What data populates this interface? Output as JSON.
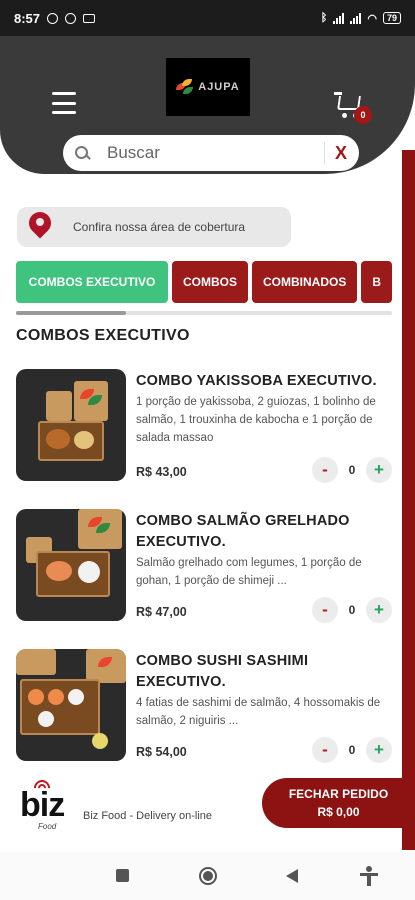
{
  "status_bar": {
    "time": "8:57",
    "battery": "79"
  },
  "header": {
    "logo_text": "AJUPA",
    "cart_count": "0",
    "search_placeholder": "Buscar",
    "search_clear": "X"
  },
  "coverage": {
    "label": "Confira nossa área de cobertura"
  },
  "tabs": [
    {
      "label": "COMBOS EXECUTIVO",
      "active": true
    },
    {
      "label": "COMBOS",
      "active": false
    },
    {
      "label": "COMBINADOS",
      "active": false
    },
    {
      "label": "B",
      "active": false
    }
  ],
  "section_title": "COMBOS EXECUTIVO",
  "products": [
    {
      "name": "COMBO YAKISSOBA EXECUTIVO.",
      "description": "1 porção de yakissoba, 2 guiozas, 1 bolinho de salmão, 1 trouxinha de kabocha e 1 porção de salada massao",
      "price": "R$ 43,00",
      "quantity": "0"
    },
    {
      "name": "COMBO SALMÃO GRELHADO EXECUTIVO.",
      "description": "Salmão grelhado com legumes, 1 porção de gohan, 1 porção de shimeji ...",
      "price": "R$ 47,00",
      "quantity": "0"
    },
    {
      "name": "COMBO SUSHI SASHIMI EXECUTIVO.",
      "description": "4 fatias de sashimi de salmão, 4 hossomakis de salmão, 2 niguiris ...",
      "price": "R$ 54,00",
      "quantity": "0"
    }
  ],
  "stepper": {
    "minus": "-",
    "plus": "+"
  },
  "footer": {
    "brand": "biz",
    "brand_sub": "Food",
    "tagline": "Biz Food - Delivery on-line",
    "checkout_label": "FECHAR PEDIDO",
    "checkout_total": "R$ 0,00"
  },
  "colors": {
    "header_bg": "#3a3a3a",
    "brand_red": "#8d1212",
    "active_tab": "#3fc37e",
    "tab_red": "#9b1b1b"
  }
}
